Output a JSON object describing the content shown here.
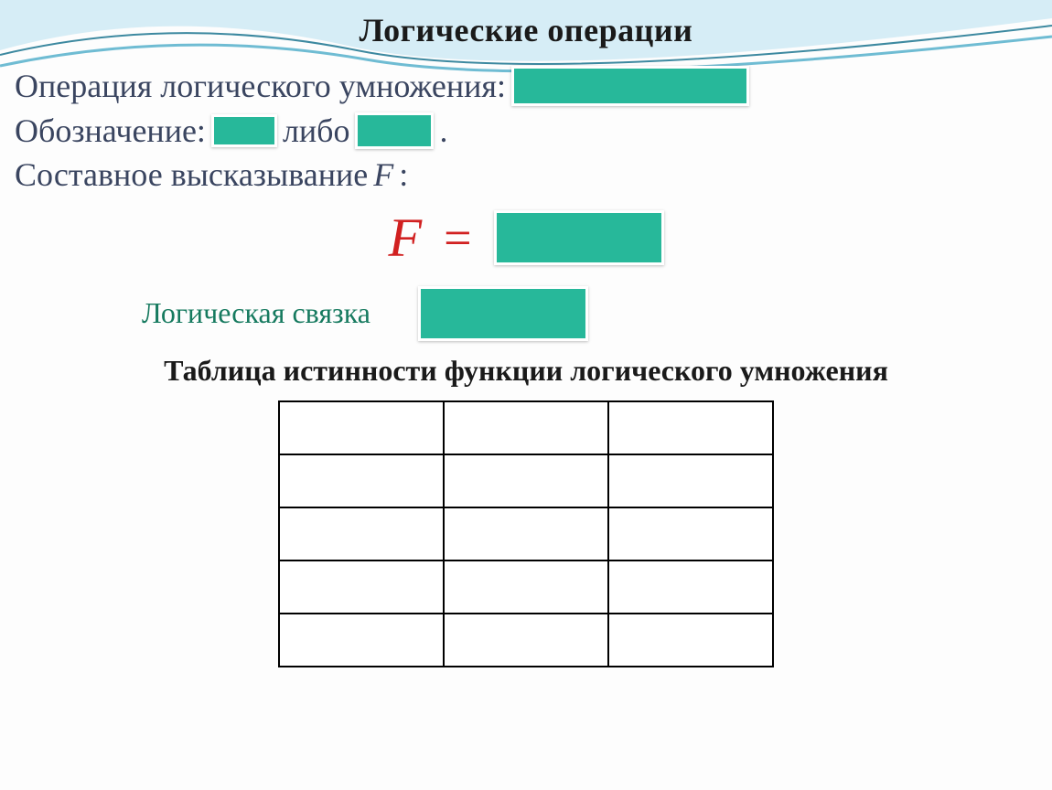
{
  "title": "Логические операции",
  "lines": {
    "operation": "Операция логического умножения:",
    "notation_prefix": "Обозначение:",
    "notation_sep": "либо",
    "notation_suffix": ".",
    "compound": "Составное высказывание",
    "compound_var": "F",
    "compound_suffix": ":"
  },
  "equation": {
    "lhs": "F",
    "eq": "="
  },
  "connective": "Логическая связка",
  "table_title": "Таблица истинности функции логического умножения",
  "truth_table": {
    "rows": 5,
    "cols": 3
  },
  "chart_data": {
    "type": "table",
    "title": "Таблица истинности функции логического умножения",
    "columns": [
      "",
      "",
      ""
    ],
    "rows": [
      [
        "",
        "",
        ""
      ],
      [
        "",
        "",
        ""
      ],
      [
        "",
        "",
        ""
      ],
      [
        "",
        "",
        ""
      ],
      [
        "",
        "",
        ""
      ]
    ]
  }
}
